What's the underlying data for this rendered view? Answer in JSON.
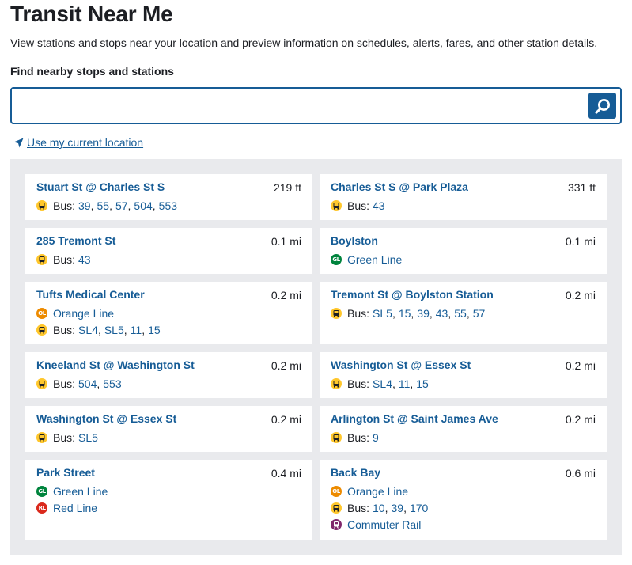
{
  "page": {
    "title": "Transit Near Me",
    "intro": "View stations and stops near your location and preview information on schedules, alerts, fares, and other station details.",
    "search_label": "Find nearby stops and stations",
    "search_placeholder": "",
    "search_value": "",
    "search_icon": "search-icon",
    "geo_icon": "location-arrow-icon",
    "geo_link": "Use my current location"
  },
  "colors": {
    "link": "#165c96",
    "panel": "#e9eaed",
    "bus": "#ffc72c",
    "green_line": "#00843d",
    "orange_line": "#ed8b00",
    "red_line": "#da291c",
    "commuter_rail": "#80276c"
  },
  "stops": [
    {
      "name": "Stuart St @ Charles St S",
      "distance": "219 ft",
      "routes": [
        {
          "icon": "bus-icon",
          "label": "Bus:",
          "items": [
            "39",
            "55",
            "57",
            "504",
            "553"
          ]
        }
      ]
    },
    {
      "name": "Charles St S @ Park Plaza",
      "distance": "331 ft",
      "routes": [
        {
          "icon": "bus-icon",
          "label": "Bus:",
          "items": [
            "43"
          ]
        }
      ]
    },
    {
      "name": "285 Tremont St",
      "distance": "0.1 mi",
      "routes": [
        {
          "icon": "bus-icon",
          "label": "Bus:",
          "items": [
            "43"
          ]
        }
      ]
    },
    {
      "name": "Boylston",
      "distance": "0.1 mi",
      "routes": [
        {
          "icon": "green-line-icon",
          "badge": "GL",
          "items": [
            "Green Line"
          ]
        }
      ]
    },
    {
      "name": "Tufts Medical Center",
      "distance": "0.2 mi",
      "routes": [
        {
          "icon": "orange-line-icon",
          "badge": "OL",
          "items": [
            "Orange Line"
          ]
        },
        {
          "icon": "bus-icon",
          "label": "Bus:",
          "items": [
            "SL4",
            "SL5",
            "11",
            "15"
          ]
        }
      ]
    },
    {
      "name": "Tremont St @ Boylston Station",
      "distance": "0.2 mi",
      "routes": [
        {
          "icon": "bus-icon",
          "label": "Bus:",
          "items": [
            "SL5",
            "15",
            "39",
            "43",
            "55",
            "57"
          ]
        }
      ]
    },
    {
      "name": "Kneeland St @ Washington St",
      "distance": "0.2 mi",
      "routes": [
        {
          "icon": "bus-icon",
          "label": "Bus:",
          "items": [
            "504",
            "553"
          ]
        }
      ]
    },
    {
      "name": "Washington St @ Essex St",
      "distance": "0.2 mi",
      "routes": [
        {
          "icon": "bus-icon",
          "label": "Bus:",
          "items": [
            "SL4",
            "11",
            "15"
          ]
        }
      ]
    },
    {
      "name": "Washington St @ Essex St",
      "distance": "0.2 mi",
      "routes": [
        {
          "icon": "bus-icon",
          "label": "Bus:",
          "items": [
            "SL5"
          ]
        }
      ]
    },
    {
      "name": "Arlington St @ Saint James Ave",
      "distance": "0.2 mi",
      "routes": [
        {
          "icon": "bus-icon",
          "label": "Bus:",
          "items": [
            "9"
          ]
        }
      ]
    },
    {
      "name": "Park Street",
      "distance": "0.4 mi",
      "routes": [
        {
          "icon": "green-line-icon",
          "badge": "GL",
          "items": [
            "Green Line"
          ]
        },
        {
          "icon": "red-line-icon",
          "badge": "RL",
          "items": [
            "Red Line"
          ]
        }
      ]
    },
    {
      "name": "Back Bay",
      "distance": "0.6 mi",
      "routes": [
        {
          "icon": "orange-line-icon",
          "badge": "OL",
          "items": [
            "Orange Line"
          ]
        },
        {
          "icon": "bus-icon",
          "label": "Bus:",
          "items": [
            "10",
            "39",
            "170"
          ]
        },
        {
          "icon": "commuter-rail-icon",
          "items": [
            "Commuter Rail"
          ]
        }
      ]
    }
  ]
}
